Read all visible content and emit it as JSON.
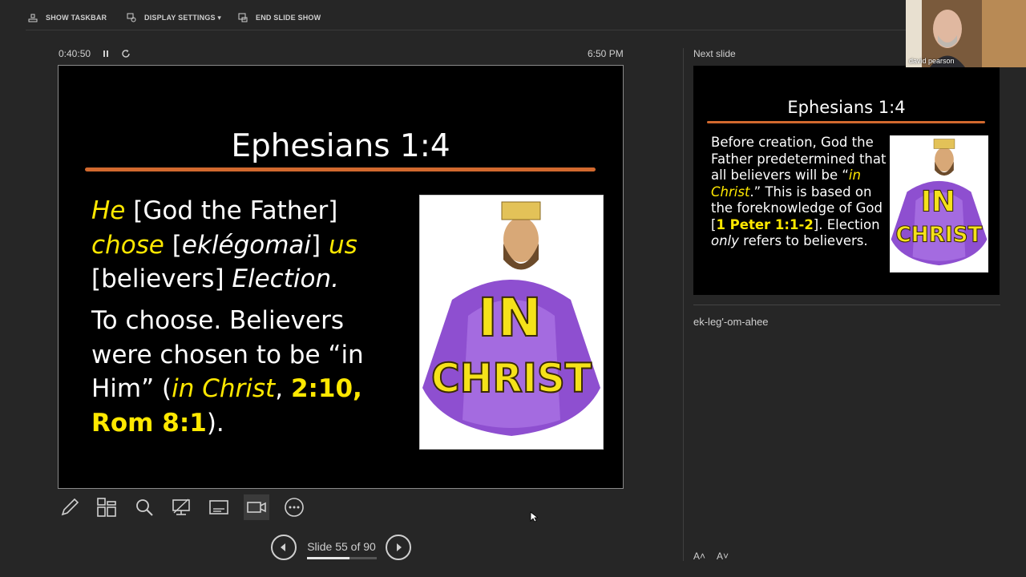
{
  "toolbar": {
    "show_taskbar": "SHOW TASKBAR",
    "display_settings": "DISPLAY SETTINGS ▾",
    "end_slide_show": "END SLIDE SHOW"
  },
  "timer": {
    "elapsed": "0:40:50",
    "clock": "6:50 PM"
  },
  "current_slide": {
    "title": "Ephesians 1:4",
    "line1_a": "He",
    "line1_b": " [God the Father]",
    "line2_a": "chose",
    "line2_b": " [",
    "line2_c": "eklégomai",
    "line2_d": "] ",
    "line2_e": "us",
    "line3_a": "[believers] ",
    "line3_b": "Election.",
    "para2_a": "To choose. Believers were chosen to be “in Him” (",
    "para2_b": "in Christ",
    "para2_c": ", ",
    "para2_d": "2:10, Rom 8:1",
    "para2_e": ").",
    "image_text_1": "IN",
    "image_text_2": "CHRIST"
  },
  "navigation": {
    "slide_counter": "Slide 55 of 90",
    "current": 55,
    "total": 90
  },
  "next_slide": {
    "label": "Next slide",
    "title": "Ephesians 1:4",
    "body_a": "Before creation, God the Father predetermined that all believers will be “",
    "body_b": "in Christ",
    "body_c": ".” This is based on the foreknowledge of God [",
    "body_d": "1 Peter 1:1-2",
    "body_e": "]. Election ",
    "body_f": "only",
    "body_g": " refers to believers.",
    "image_text_1": "IN",
    "image_text_2": "CHRIST"
  },
  "notes": {
    "text": "ek-leg'-om-ahee"
  },
  "font_controls": {
    "increase": "A˄",
    "decrease": "A˅"
  },
  "webcam": {
    "name": "david pearson"
  },
  "colors": {
    "background": "#262626",
    "highlight_yellow": "#ffe800",
    "rule_orange": "#d2692e"
  }
}
